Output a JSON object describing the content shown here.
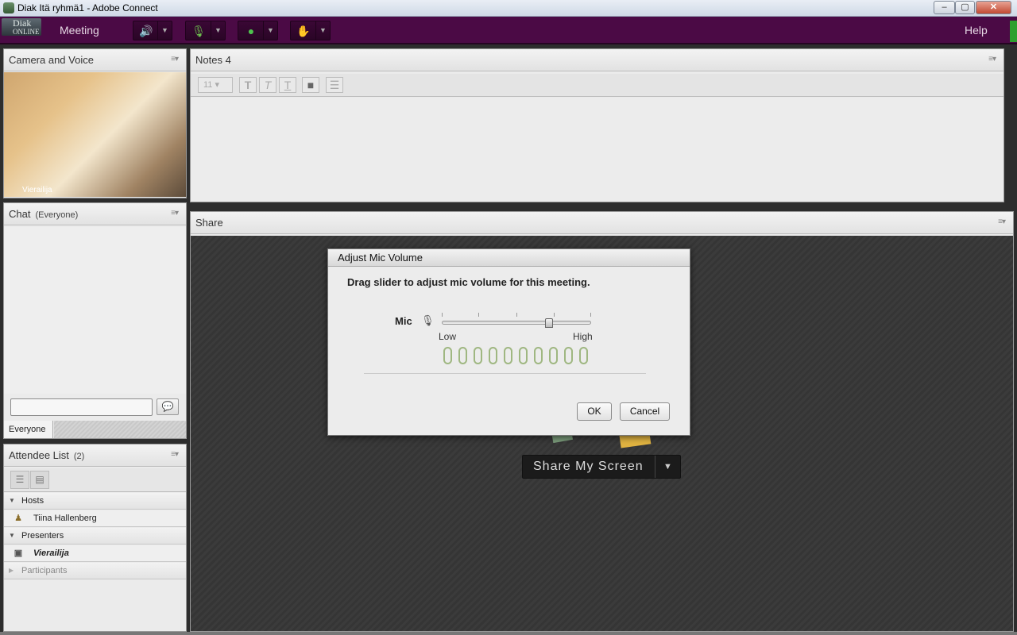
{
  "window": {
    "title": "Diak Itä ryhmä1 - Adobe Connect",
    "minimize": "–",
    "maximize": "▢",
    "close": "✕"
  },
  "menubar": {
    "logo_line1": "Diak",
    "logo_line2": "ONLINE",
    "meeting": "Meeting",
    "help": "Help"
  },
  "camera_pod": {
    "title": "Camera and Voice",
    "video_name": "Vierailija"
  },
  "notes_pod": {
    "title": "Notes 4",
    "font_size": "11",
    "toolbar": [
      "T",
      "T",
      "T",
      "■",
      "☰"
    ]
  },
  "share_pod": {
    "title": "Share",
    "share_button": "Share My Screen",
    "dropdown": "▼"
  },
  "chat_pod": {
    "title": "Chat",
    "scope": "(Everyone)",
    "send_icon": "💬",
    "tab": "Everyone"
  },
  "attendee_pod": {
    "title": "Attendee List",
    "count": "(2)",
    "groups": {
      "hosts": "Hosts",
      "host_member": "Tiina Hallenberg",
      "presenters": "Presenters",
      "presenter_member": "Vierailija",
      "participants": "Participants"
    }
  },
  "dialog": {
    "title": "Adjust Mic Volume",
    "message": "Drag slider to adjust mic volume for this meeting.",
    "mic_label": "Mic",
    "low": "Low",
    "high": "High",
    "slider_level": 0.72,
    "meter_digits": "0000000000",
    "ok": "OK",
    "cancel": "Cancel",
    "meter_color": "#9fb781"
  },
  "pod_menu_icon": "≡▾"
}
